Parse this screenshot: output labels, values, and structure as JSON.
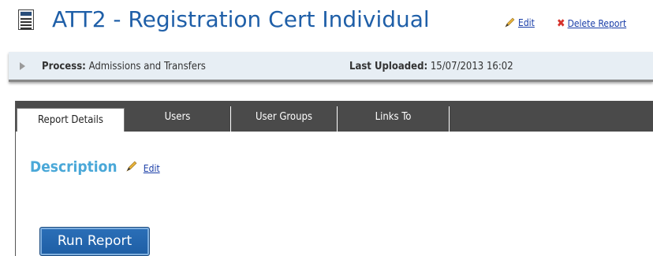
{
  "header": {
    "icon": "report-icon",
    "title": "ATT2 - Registration Cert Individual",
    "edit_label": "Edit",
    "delete_label": "Delete Report"
  },
  "info": {
    "process_label": "Process:",
    "process_value": "Admissions and Transfers",
    "uploaded_label": "Last Uploaded:",
    "uploaded_value": "15/07/2013 16:02"
  },
  "tabs": [
    {
      "label": "Report Details",
      "active": true
    },
    {
      "label": "Users",
      "active": false
    },
    {
      "label": "User Groups",
      "active": false
    },
    {
      "label": "Links To",
      "active": false
    }
  ],
  "content": {
    "description_label": "Description",
    "description_edit": "Edit",
    "run_button": "Run Report"
  },
  "colors": {
    "title": "#1f5fa8",
    "link": "#1a3ea8",
    "tabstrip": "#4a4a4a",
    "description": "#4aa8d8",
    "button": "#2b6fb8"
  }
}
